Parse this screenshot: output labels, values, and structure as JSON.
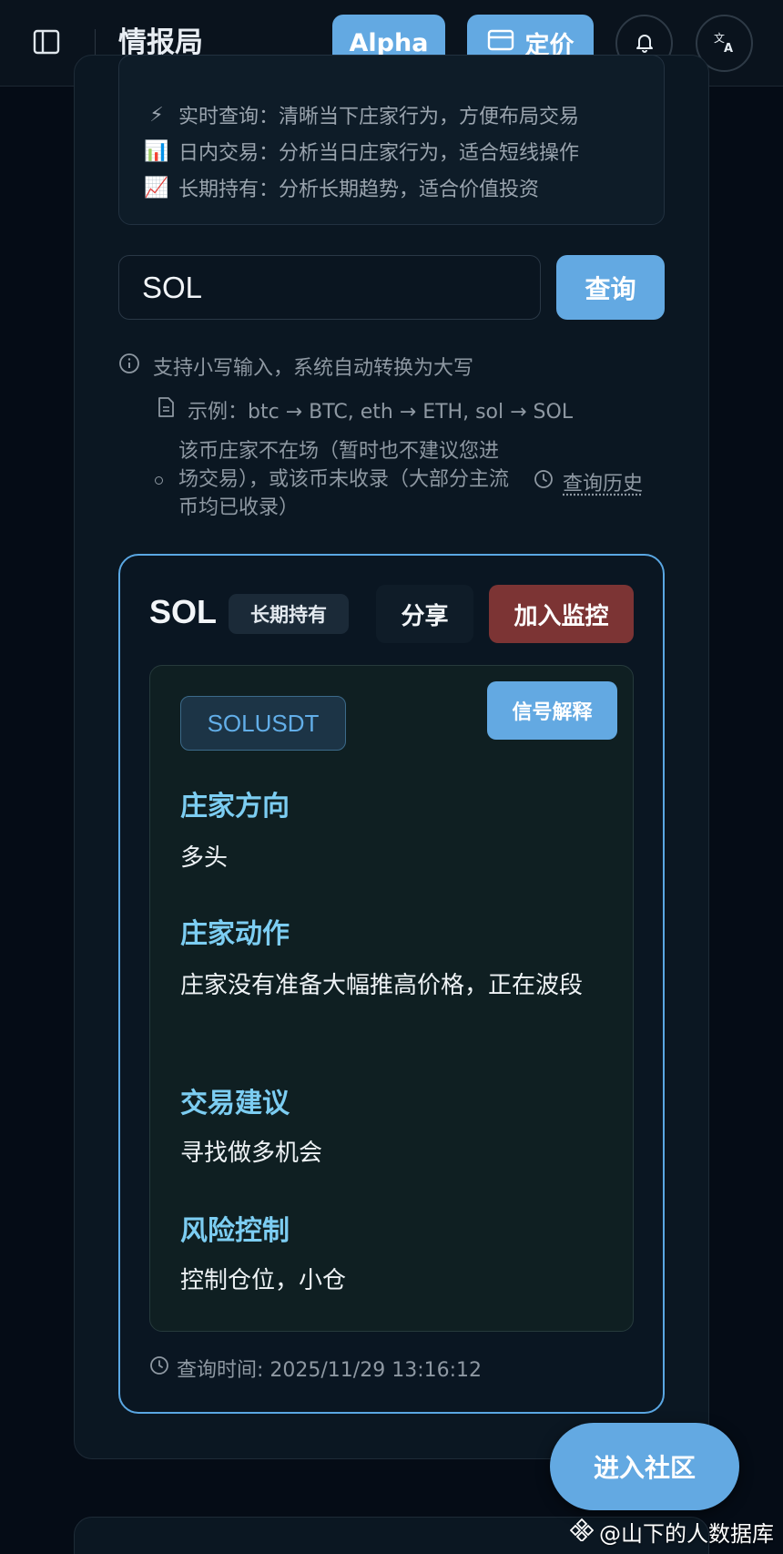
{
  "header": {
    "title": "情报局",
    "alpha_label": "Alpha",
    "pricing_label": "定价"
  },
  "modes": [
    {
      "icon": "⚡",
      "text": "实时查询：清晰当下庄家行为，方便布局交易"
    },
    {
      "icon": "📊",
      "text": "日内交易：分析当日庄家行为，适合短线操作"
    },
    {
      "icon": "📈",
      "text": "长期持有：分析长期趋势，适合价值投资"
    }
  ],
  "search": {
    "value": "SOL",
    "button_label": "查询"
  },
  "hints": {
    "lowercase": "支持小写输入，系统自动转换为大写",
    "example": "示例：btc → BTC, eth → ETH, sol → SOL",
    "status": "该币庄家不在场（暂时也不建议您进场交易），或该币未收录（大部分主流币均已收录）",
    "history_label": "查询历史"
  },
  "result": {
    "symbol": "SOL",
    "mode_tag": "长期持有",
    "share_label": "分享",
    "monitor_label": "加入监控",
    "pair": "SOLUSDT",
    "explain_label": "信号解释",
    "sections": [
      {
        "title": "庄家方向",
        "body": "多头"
      },
      {
        "title": "庄家动作",
        "body": "庄家没有准备大幅推高价格，正在波段"
      },
      {
        "title": "交易建议",
        "body": "寻找做多机会"
      },
      {
        "title": "风险控制",
        "body": "控制仓位，小仓"
      }
    ],
    "query_time": "查询时间: 2025/11/29 13:16:12"
  },
  "community_label": "进入社区",
  "watermark": "@山下的人数据库",
  "colors": {
    "accent": "#63a9e2",
    "danger": "#7c3434",
    "section_title": "#7ccdf2"
  }
}
